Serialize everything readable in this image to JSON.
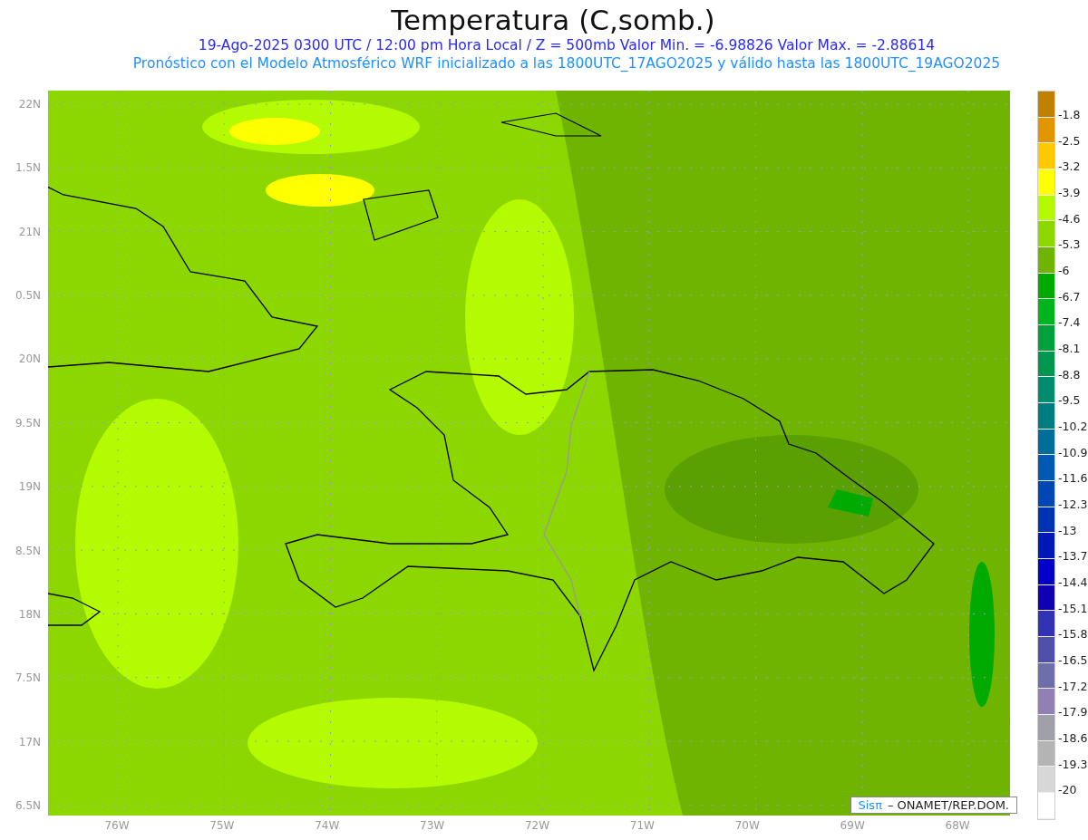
{
  "title": "Temperatura (C,somb.)",
  "subtitle": "19-Ago-2025  0300 UTC / 12:00 pm Hora Local / Z = 500mb  Valor Min. = -6.98826  Valor Max. = -2.88614",
  "forecast_note": "Pronóstico con el Modelo Atmosférico WRF inicializado a las 1800UTC_17AGO2025 y válido hasta las  1800UTC_19AGO2025",
  "latitude_labels": [
    "22N",
    "1.5N",
    "21N",
    "0.5N",
    "20N",
    "9.5N",
    "19N",
    "8.5N",
    "18N",
    "7.5N",
    "17N",
    "6.5N"
  ],
  "longitude_labels": [
    "76W",
    "75W",
    "74W",
    "73W",
    "72W",
    "71W",
    "70W",
    "69W",
    "68W"
  ],
  "credit": {
    "logo": "Sisπ",
    "text": "– ONAMET/REP.DOM."
  },
  "colorbar": [
    {
      "color": "#c08000",
      "label": "-1.8"
    },
    {
      "color": "#e19600",
      "label": "-2.5"
    },
    {
      "color": "#ffc800",
      "label": "-3.2"
    },
    {
      "color": "#ffff00",
      "label": "-3.9"
    },
    {
      "color": "#b4fa00",
      "label": "-4.6"
    },
    {
      "color": "#8cd700",
      "label": "-5.3"
    },
    {
      "color": "#6eb400",
      "label": "-6"
    },
    {
      "color": "#00aa00",
      "label": "-6.7"
    },
    {
      "color": "#00b41e",
      "label": "-7.4"
    },
    {
      "color": "#00a03c",
      "label": "-8.1"
    },
    {
      "color": "#009650",
      "label": "-8.8"
    },
    {
      "color": "#008c6e",
      "label": "-9.5"
    },
    {
      "color": "#007d80",
      "label": "-10.2"
    },
    {
      "color": "#006e96",
      "label": "-10.9"
    },
    {
      "color": "#005ab4",
      "label": "-11.6"
    },
    {
      "color": "#0046b4",
      "label": "-12.3"
    },
    {
      "color": "#0032b4",
      "label": "-13"
    },
    {
      "color": "#0018b4",
      "label": "-13.7"
    },
    {
      "color": "#0000c8",
      "label": "-14.4"
    },
    {
      "color": "#1000b4",
      "label": "-15.1"
    },
    {
      "color": "#3232b4",
      "label": "-15.8"
    },
    {
      "color": "#5050aa",
      "label": "-16.5"
    },
    {
      "color": "#6e6eaa",
      "label": "-17.2"
    },
    {
      "color": "#9080b4",
      "label": "-17.9"
    },
    {
      "color": "#a0a0aa",
      "label": "-18.6"
    },
    {
      "color": "#b4b4b4",
      "label": "-19.3"
    },
    {
      "color": "#d7d7d7",
      "label": "-20"
    },
    {
      "color": "#ffffff"
    }
  ]
}
